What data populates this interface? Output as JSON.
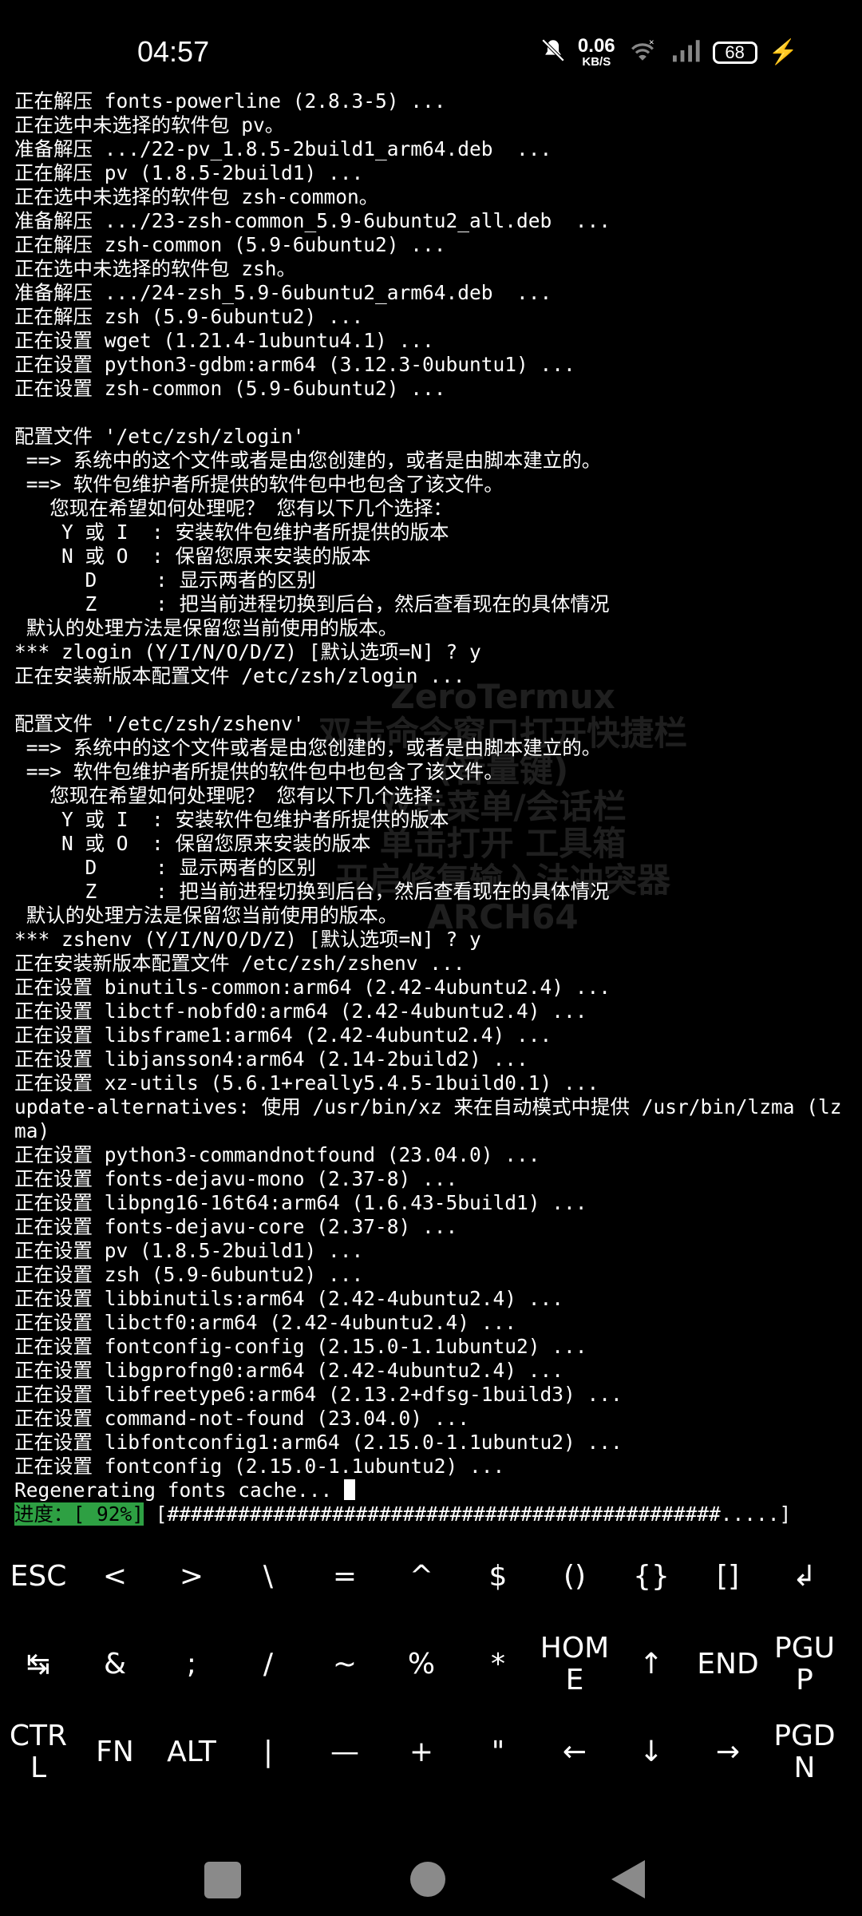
{
  "status_bar": {
    "time": "04:57",
    "net_speed_value": "0.06",
    "net_speed_unit": "KB/S",
    "battery_level": "68",
    "icons": [
      "mute-icon",
      "wifi-icon",
      "signal-icon",
      "battery-icon",
      "charging-icon"
    ]
  },
  "terminal": {
    "lines": [
      "正在解压 fonts-powerline (2.8.3-5) ...",
      "正在选中未选择的软件包 pv。",
      "准备解压 .../22-pv_1.8.5-2build1_arm64.deb  ...",
      "正在解压 pv (1.8.5-2build1) ...",
      "正在选中未选择的软件包 zsh-common。",
      "准备解压 .../23-zsh-common_5.9-6ubuntu2_all.deb  ...",
      "正在解压 zsh-common (5.9-6ubuntu2) ...",
      "正在选中未选择的软件包 zsh。",
      "准备解压 .../24-zsh_5.9-6ubuntu2_arm64.deb  ...",
      "正在解压 zsh (5.9-6ubuntu2) ...",
      "正在设置 wget (1.21.4-1ubuntu4.1) ...",
      "正在设置 python3-gdbm:arm64 (3.12.3-0ubuntu1) ...",
      "正在设置 zsh-common (5.9-6ubuntu2) ...",
      "",
      "配置文件 '/etc/zsh/zlogin'",
      " ==> 系统中的这个文件或者是由您创建的，或者是由脚本建立的。",
      " ==> 软件包维护者所提供的软件包中也包含了该文件。",
      "   您现在希望如何处理呢？ 您有以下几个选择：",
      "    Y 或 I  : 安装软件包维护者所提供的版本",
      "    N 或 O  : 保留您原来安装的版本",
      "      D     : 显示两者的区别",
      "      Z     : 把当前进程切换到后台，然后查看现在的具体情况",
      " 默认的处理方法是保留您当前使用的版本。",
      "*** zlogin (Y/I/N/O/D/Z) [默认选项=N] ? y",
      "正在安装新版本配置文件 /etc/zsh/zlogin ...",
      "",
      "配置文件 '/etc/zsh/zshenv'",
      " ==> 系统中的这个文件或者是由您创建的，或者是由脚本建立的。",
      " ==> 软件包维护者所提供的软件包中也包含了该文件。",
      "   您现在希望如何处理呢？ 您有以下几个选择：",
      "    Y 或 I  : 安装软件包维护者所提供的版本",
      "    N 或 O  : 保留您原来安装的版本",
      "      D     : 显示两者的区别",
      "      Z     : 把当前进程切换到后台，然后查看现在的具体情况",
      " 默认的处理方法是保留您当前使用的版本。",
      "*** zshenv (Y/I/N/O/D/Z) [默认选项=N] ? y",
      "正在安装新版本配置文件 /etc/zsh/zshenv ...",
      "正在设置 binutils-common:arm64 (2.42-4ubuntu2.4) ...",
      "正在设置 libctf-nobfd0:arm64 (2.42-4ubuntu2.4) ...",
      "正在设置 libsframe1:arm64 (2.42-4ubuntu2.4) ...",
      "正在设置 libjansson4:arm64 (2.14-2build2) ...",
      "正在设置 xz-utils (5.6.1+really5.4.5-1build0.1) ...",
      "update-alternatives: 使用 /usr/bin/xz 来在自动模式中提供 /usr/bin/lzma (lzma)",
      "正在设置 python3-commandnotfound (23.04.0) ...",
      "正在设置 fonts-dejavu-mono (2.37-8) ...",
      "正在设置 libpng16-16t64:arm64 (1.6.43-5build1) ...",
      "正在设置 fonts-dejavu-core (2.37-8) ...",
      "正在设置 pv (1.8.5-2build1) ...",
      "正在设置 zsh (5.9-6ubuntu2) ...",
      "正在设置 libbinutils:arm64 (2.42-4ubuntu2.4) ...",
      "正在设置 libctf0:arm64 (2.42-4ubuntu2.4) ...",
      "正在设置 fontconfig-config (2.15.0-1.1ubuntu2) ...",
      "正在设置 libgprofng0:arm64 (2.42-4ubuntu2.4) ...",
      "正在设置 libfreetype6:arm64 (2.13.2+dfsg-1build3) ...",
      "正在设置 command-not-found (23.04.0) ...",
      "正在设置 libfontconfig1:arm64 (2.15.0-1.1ubuntu2) ...",
      "正在设置 fontconfig (2.15.0-1.1ubuntu2) ...",
      "Regenerating fonts cache... "
    ],
    "progress_label": "进度：[ 92%]",
    "progress_bar": " [###############################################.....]",
    "progress_percent": 92
  },
  "watermark": {
    "lines": [
      "ZeroTermux",
      "双击命令窗口打开快捷栏",
      "(音量键)",
      "双击菜单/会话栏",
      "单击打开 工具箱",
      "开启修复输入法冲突器",
      "ARCH64"
    ]
  },
  "extra_keys": {
    "row1": [
      "ESC",
      "<",
      ">",
      "\\",
      "=",
      "^",
      "$",
      "()",
      "{}",
      "[]",
      "↲"
    ],
    "row2": [
      "↹",
      "&",
      ";",
      "/",
      "~",
      "%",
      "*",
      "HOM\nE",
      "↑",
      "END",
      "PGU\nP"
    ],
    "row3": [
      "CTR\nL",
      "FN",
      "ALT",
      "|",
      "—",
      "+",
      "\"",
      "←",
      "↓",
      "→",
      "PGD\nN"
    ]
  },
  "nav_bar": {
    "icons": [
      "recents-square-icon",
      "home-circle-icon",
      "back-triangle-icon"
    ]
  }
}
